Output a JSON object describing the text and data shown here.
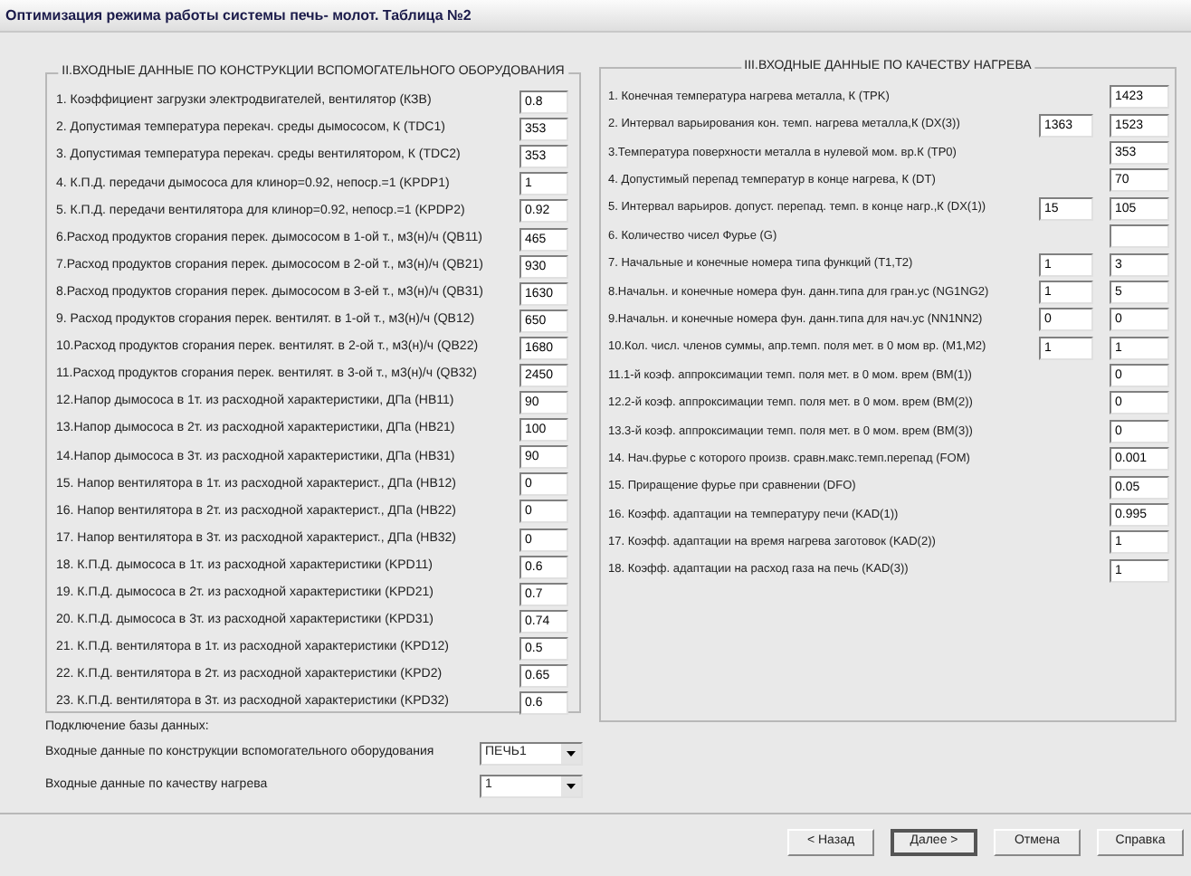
{
  "window": {
    "title": "Оптимизация режима работы системы печь- молот. Таблица №2"
  },
  "construction": {
    "title": "II.ВХОДНЫЕ ДАННЫЕ ПО КОНСТРУКЦИИ ВСПОМОГАТЕЛЬНОГО ОБОРУДОВАНИЯ",
    "rows": [
      {
        "label": "1. Коэффициент загрузки электродвигателей, вентилятор  (КЗВ)",
        "value": "0.8"
      },
      {
        "label": "2. Допустимая температура перекач. среды дымососом, К  (TDC1)",
        "value": "353"
      },
      {
        "label": "3. Допустимая температура перекач. среды вентилятором, К  (TDC2)",
        "value": "353"
      },
      {
        "label": "4. К.П.Д. передачи дымососа для клинор=0.92, непоср.=1  (KPDP1)",
        "value": "1"
      },
      {
        "label": "5. К.П.Д. передачи вентилятора для клинор=0.92, непоср.=1  (KPDP2)",
        "value": "0.92"
      },
      {
        "label": "6.Расход продуктов сгорания перек. дымососом в 1-ой т., м3(н)/ч  (QB11)",
        "value": "465"
      },
      {
        "label": "7.Расход продуктов сгорания перек. дымососом в 2-ой т., м3(н)/ч  (QB21)",
        "value": "930"
      },
      {
        "label": "8.Расход продуктов сгорания перек. дымососом в 3-ей т., м3(н)/ч  (QB31)",
        "value": "1630"
      },
      {
        "label": "9. Расход продуктов сгорания перек. вентилят. в 1-ой т., м3(н)/ч  (QB12)",
        "value": "650"
      },
      {
        "label": "10.Расход продуктов сгорания перек. вентилят. в 2-ой т., м3(н)/ч  (QB22)",
        "value": "1680"
      },
      {
        "label": "11.Расход продуктов сгорания перек. вентилят. в 3-ой т., м3(н)/ч  (QB32)",
        "value": "2450"
      },
      {
        "label": "12.Напор дымососа в 1т. из расходной характеристики, ДПа  (HB11)",
        "value": "90"
      },
      {
        "label": "13.Напор дымососа в 2т. из расходной характеристики, ДПа  (HB21)",
        "value": "100"
      },
      {
        "label": "14.Напор дымососа в 3т. из расходной характеристики, ДПа  (HB31)",
        "value": "90"
      },
      {
        "label": "15. Напор вентилятора в 1т. из расходной характерист., ДПа  (HB12)",
        "value": "0"
      },
      {
        "label": "16. Напор вентилятора в 2т. из расходной характерист., ДПа  (HB22)",
        "value": "0"
      },
      {
        "label": "17. Напор вентилятора в 3т. из расходной характерист., ДПа  (HB32)",
        "value": "0"
      },
      {
        "label": "18. К.П.Д. дымососа в 1т. из расходной характеристики  (KPD11)",
        "value": "0.6"
      },
      {
        "label": "19. К.П.Д. дымососа в 2т. из расходной характеристики  (KPD21)",
        "value": "0.7"
      },
      {
        "label": "20. К.П.Д. дымососа в 3т. из расходной характеристики  (KPD31)",
        "value": "0.74"
      },
      {
        "label": "21. К.П.Д. вентилятора в 1т. из расходной характеристики  (KPD12)",
        "value": "0.5"
      },
      {
        "label": "22. К.П.Д. вентилятора в 2т. из расходной характеристики  (KPD2)",
        "value": "0.65"
      },
      {
        "label": "23. К.П.Д. вентилятора в 3т. из расходной характеристики  (KPD32)",
        "value": "0.6"
      }
    ]
  },
  "database": {
    "heading": "Подключение базы данных:",
    "selectors": [
      {
        "label": "Входные данные по конструкции вспомогательного оборудования",
        "value": "ПЕЧЬ1"
      },
      {
        "label": "Входные данные по качеству нагрева",
        "value": "1"
      }
    ]
  },
  "heating": {
    "title": "III.ВХОДНЫЕ ДАННЫЕ ПО КАЧЕСТВУ НАГРЕВА",
    "rows": [
      {
        "kind": "filled",
        "label": "1. Конечная температура нагрева металла, К  (TPK)",
        "values": [
          "1423"
        ]
      },
      {
        "kind": "filled",
        "label": "2. Интервал варьирования кон. темп. нагрева металла,К  (DX(3))",
        "values": [
          "1363",
          "1523"
        ]
      },
      {
        "kind": "filled",
        "label": "3.Температура поверхности металла в нулевой мом. вр.К  (TP0)",
        "values": [
          "353"
        ]
      },
      {
        "kind": "filled",
        "label": "4. Допустимый перепад температур в конце нагрева, К  (DT)",
        "values": [
          "70"
        ]
      },
      {
        "kind": "filled",
        "label": "5. Интервал варьиров. допуст. перепад. темп. в конце нагр.,К  (DX(1))",
        "values": [
          "15",
          "105"
        ]
      },
      {
        "kind": "blank",
        "label": "6. Количество чисел Фурье (G)"
      },
      {
        "kind": "filled",
        "label": "7. Начальные и конечные номера типа функций  (T1,T2)",
        "values": [
          "1",
          "3"
        ]
      },
      {
        "kind": "filled",
        "label": "8.Начальн. и конечные номера фун. данн.типа для гран.ус  (NG1NG2)",
        "values": [
          "1",
          "5"
        ]
      },
      {
        "kind": "filled",
        "label": "9.Начальн. и конечные номера фун. данн.типа для нач.ус  (NN1NN2)",
        "values": [
          "0",
          "0"
        ]
      },
      {
        "kind": "filled",
        "label": "10.Кол. числ. членов суммы, апр.темп. поля мет. в 0 мом вр. (M1,M2)",
        "values": [
          "1",
          "1"
        ]
      },
      {
        "kind": "filled",
        "label": "11.1-й коэф. аппроксимации темп. поля мет. в 0 мом. врем  (BM(1))",
        "values": [
          "0"
        ]
      },
      {
        "kind": "filled",
        "label": "12.2-й коэф. аппроксимации темп. поля мет. в 0 мом. врем  (BM(2))",
        "values": [
          "0"
        ]
      },
      {
        "kind": "filled",
        "label": "13.3-й коэф. аппроксимации темп. поля мет. в 0 мом. врем  (BM(3))",
        "values": [
          "0"
        ]
      },
      {
        "kind": "filled",
        "label": "14. Нач.фурье с которого произв. сравн.макс.темп.перепад (FOM)",
        "values": [
          "0.001"
        ]
      },
      {
        "kind": "filled",
        "label": "15. Приращение фурье при сравнении  (DFO)",
        "values": [
          "0.05"
        ]
      },
      {
        "kind": "filled",
        "label": "16. Коэфф. адаптации на температуру печи  (KAD(1))",
        "values": [
          "0.995"
        ]
      },
      {
        "kind": "filled",
        "label": "17. Коэфф. адаптации на время нагрева заготовок  (KAD(2))",
        "values": [
          "1"
        ]
      },
      {
        "kind": "filled",
        "label": "18. Коэфф. адаптации на расход газа на печь  (KAD(3))",
        "values": [
          "1"
        ]
      }
    ]
  },
  "buttons": [
    {
      "label": "< Назад",
      "default": false
    },
    {
      "label": "Далее >",
      "default": true
    },
    {
      "label": "Отмена",
      "default": false
    },
    {
      "label": "Справка",
      "default": false
    }
  ]
}
